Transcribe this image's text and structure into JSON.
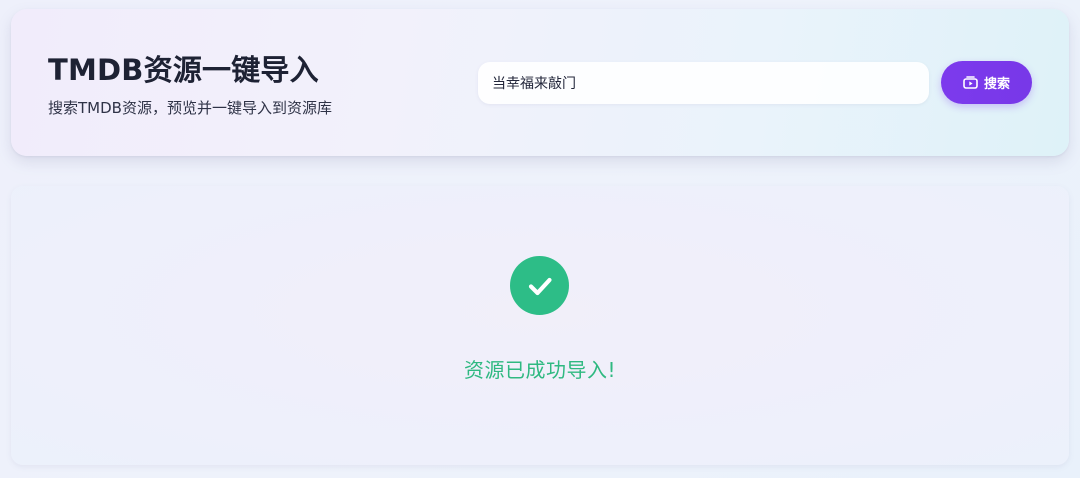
{
  "header": {
    "title": "TMDB资源一键导入",
    "subtitle": "搜索TMDB资源，预览并一键导入到资源库"
  },
  "search": {
    "value": "当幸福来敲门",
    "button_label": "搜索",
    "button_icon": "tv-play-icon"
  },
  "result": {
    "status_icon": "check-circle-icon",
    "message": "资源已成功导入!"
  },
  "colors": {
    "accent": "#7c3aed",
    "success": "#2dbd87",
    "success_text": "#2fb981",
    "title_text": "#1e2234"
  }
}
